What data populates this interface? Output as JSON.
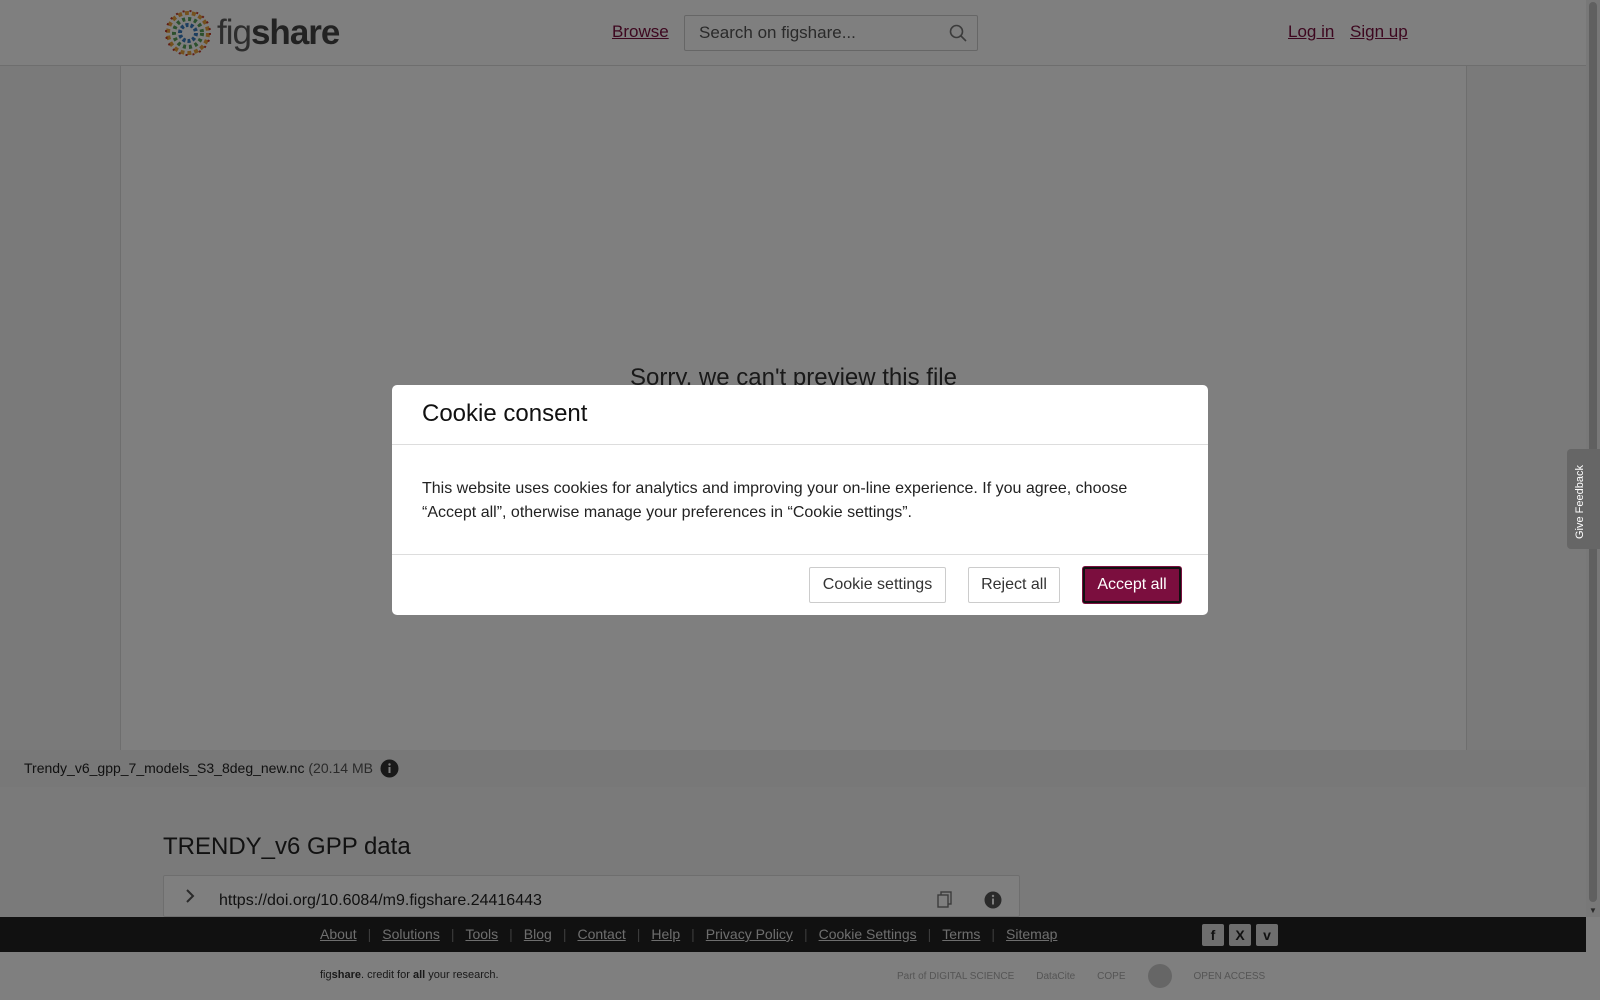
{
  "header": {
    "logo_text_light": "fig",
    "logo_text_bold": "share",
    "browse": "Browse",
    "search_placeholder": "Search on figshare...",
    "login": "Log in",
    "signup": "Sign up"
  },
  "preview": {
    "message": "Sorry, we can't preview this file"
  },
  "file": {
    "name": "Trendy_v6_gpp_7_models_S3_8deg_new.nc",
    "size": "(20.14 MB"
  },
  "item": {
    "title": "TRENDY_v6 GPP data",
    "doi": "https://doi.org/10.6084/m9.figshare.24416443"
  },
  "footer": {
    "links": [
      "About",
      "Solutions",
      "Tools",
      "Blog",
      "Contact",
      "Help",
      "Privacy Policy",
      "Cookie Settings",
      "Terms",
      "Sitemap"
    ],
    "social": [
      "f",
      "X",
      "v"
    ],
    "tagline_pre": "fig",
    "tagline_bold": "share",
    "tagline_mid": ". credit for ",
    "tagline_all": "all",
    "tagline_end": " your research.",
    "partners": [
      "Part of DIGITAL SCIENCE",
      "DataCite",
      "COPE",
      "",
      "OPEN ACCESS"
    ]
  },
  "feedback": {
    "label": "Give Feedback"
  },
  "modal": {
    "title": "Cookie consent",
    "body": "This website uses cookies for analytics and improving your on-line experience. If you agree, choose “Accept all”, otherwise manage your preferences in “Cookie settings”.",
    "cookie_settings": "Cookie settings",
    "reject_all": "Reject all",
    "accept_all": "Accept all"
  },
  "colors": {
    "brand": "#7b0e3e",
    "overlay": "rgba(0,0,0,0.5)"
  }
}
